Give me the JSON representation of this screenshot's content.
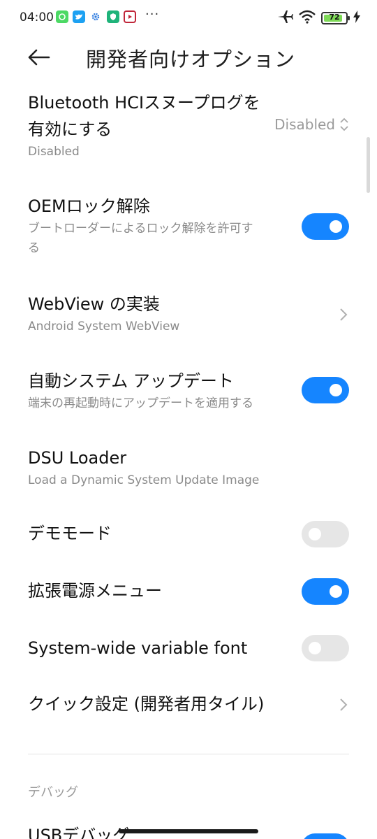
{
  "status_bar": {
    "time": "04:00",
    "more": "···",
    "battery_level": "72",
    "icons": [
      "app-green-icon",
      "twitter-icon",
      "gear-icon",
      "shield-icon",
      "youtube-icon",
      "airplane-icon",
      "wifi-icon",
      "battery-icon",
      "charging-icon"
    ]
  },
  "header": {
    "title": "開発者向けオプション"
  },
  "items": {
    "bt_hci": {
      "title_line1": "Bluetooth HCIスヌープログを",
      "title_line2": "有効にする",
      "subtitle": "Disabled",
      "value": "Disabled"
    },
    "oem_unlock": {
      "title": "OEMロック解除",
      "subtitle_line1": "ブートローダーによるロック解除を許可す",
      "subtitle_line2": "る",
      "enabled": true
    },
    "webview": {
      "title": "WebView の実装",
      "subtitle": "Android System WebView"
    },
    "auto_update": {
      "title": "自動システム アップデート",
      "subtitle": "端末の再起動時にアップデートを適用する",
      "enabled": true
    },
    "dsu_loader": {
      "title": "DSU Loader",
      "subtitle": "Load a Dynamic System Update Image"
    },
    "demo_mode": {
      "title": "デモモード",
      "enabled": false
    },
    "power_menu": {
      "title": "拡張電源メニュー",
      "enabled": true
    },
    "variable_font": {
      "title": "System-wide variable font",
      "enabled": false
    },
    "quick_settings": {
      "title": "クイック設定 (開発者用タイル)"
    }
  },
  "sections": {
    "debug_label": "デバッグ",
    "usb_debug_title": "USBデバッグ",
    "usb_debug_enabled": true
  },
  "colors": {
    "accent": "#1585ff",
    "toggle_off": "#e6e6e6",
    "subtitle": "#8a8a8a"
  }
}
